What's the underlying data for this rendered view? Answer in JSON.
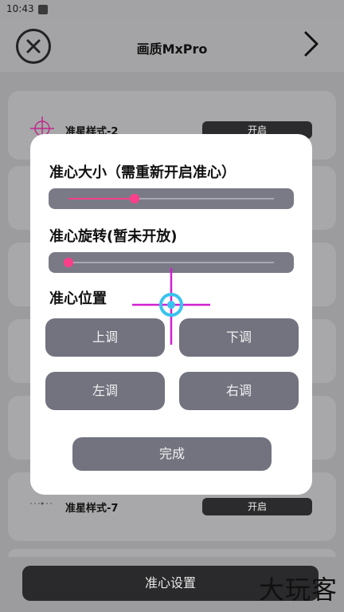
{
  "status": {
    "time": "10:43"
  },
  "header": {
    "title": "画质MxPro"
  },
  "list": [
    {
      "label": "准星样式-2",
      "toggle": "开启"
    },
    {
      "label": "准星样式-7",
      "toggle": "开启"
    }
  ],
  "bottom": {
    "button": "准心设置"
  },
  "watermark": "大玩客",
  "dialog": {
    "size_title": "准心大小（需重新开启准心）",
    "size_value": 0.32,
    "rotate_title": "准心旋转(暂未开放)",
    "rotate_value": 0.0,
    "position_title": "准心位置",
    "up": "上调",
    "down": "下调",
    "left": "左调",
    "right": "右调",
    "done": "完成"
  },
  "colors": {
    "accent": "#ff3e8a",
    "crosshair": "#d11fd1",
    "center": "#39c3ee"
  }
}
